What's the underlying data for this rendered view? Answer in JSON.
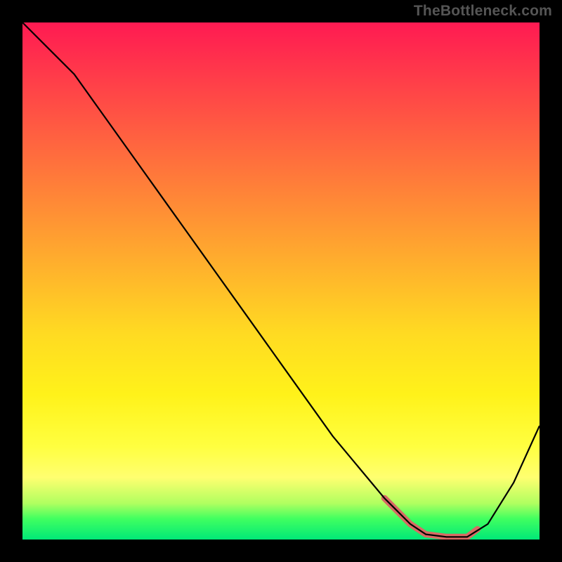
{
  "attribution": "TheBottleneck.com",
  "chart_data": {
    "type": "line",
    "title": "",
    "xlabel": "",
    "ylabel": "",
    "xlim": [
      0,
      100
    ],
    "ylim": [
      0,
      100
    ],
    "series": [
      {
        "name": "curve",
        "x": [
          0,
          5,
          10,
          15,
          20,
          25,
          30,
          35,
          40,
          45,
          50,
          55,
          60,
          65,
          70,
          72,
          75,
          78,
          82,
          86,
          90,
          95,
          100
        ],
        "values": [
          100,
          95,
          90,
          83,
          76,
          69,
          62,
          55,
          48,
          41,
          34,
          27,
          20,
          14,
          8,
          6,
          3,
          1,
          0.5,
          0.5,
          3,
          11,
          22
        ]
      },
      {
        "name": "highlight",
        "x": [
          70,
          72,
          75,
          78,
          82,
          86,
          88
        ],
        "values": [
          8,
          6,
          3,
          1,
          0.5,
          0.5,
          2
        ]
      }
    ],
    "gradient_stops": [
      {
        "pos": 0,
        "color": "#ff1a52"
      },
      {
        "pos": 50,
        "color": "#ffba2a"
      },
      {
        "pos": 82,
        "color": "#ffff40"
      },
      {
        "pos": 100,
        "color": "#00e878"
      }
    ]
  }
}
